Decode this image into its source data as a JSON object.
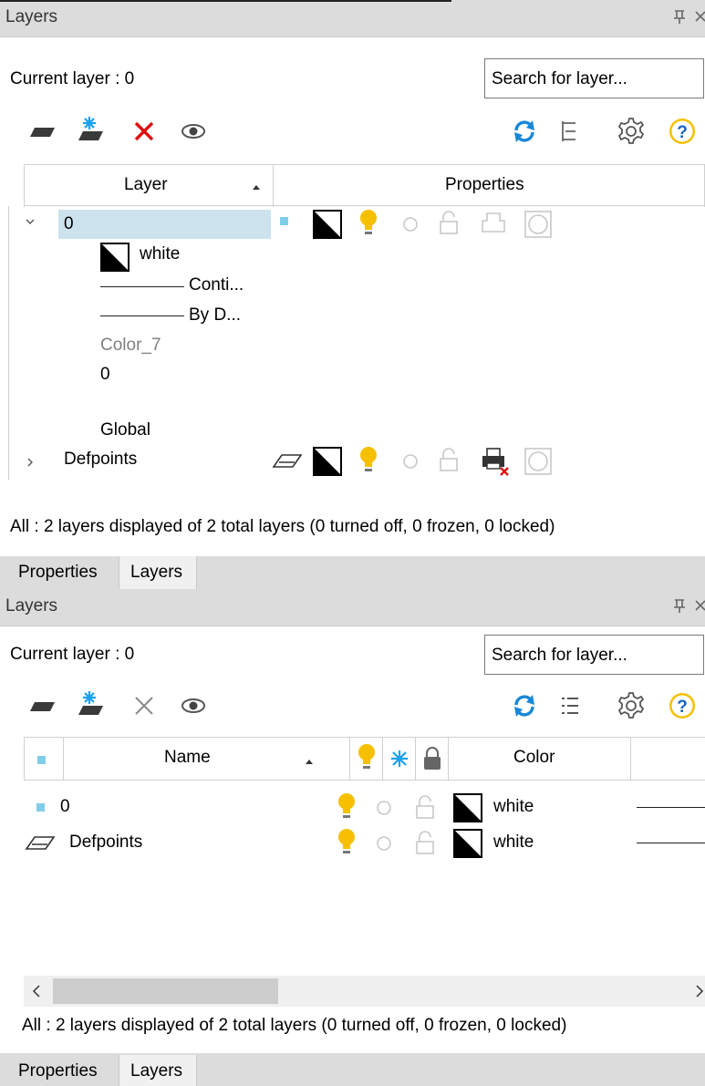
{
  "panel_top": {
    "title": "Layers",
    "current_layer": "Current layer : 0",
    "search_placeholder": "Search for layer...",
    "toolbar": [
      "new-layer-icon",
      "new-layer-frozen-icon",
      "delete-layer-icon",
      "isolate-eye-icon",
      "refresh-icon",
      "list-view-icon",
      "settings-icon",
      "help-icon"
    ],
    "columns": {
      "layer": "Layer",
      "properties": "Properties"
    },
    "tree": {
      "layer0": {
        "name": "0",
        "color_name": "white",
        "linetype": "Conti...",
        "lineweight": "By D...",
        "plot_style": "Color_7",
        "transparency": "0",
        "scope": "Global"
      },
      "defpoints": {
        "name": "Defpoints"
      }
    },
    "status": "All : 2 layers displayed of 2 total layers (0 turned off, 0 frozen, 0 locked)",
    "tabs": [
      "Properties",
      "Layers"
    ]
  },
  "panel_bottom": {
    "title": "Layers",
    "current_layer": "Current layer : 0",
    "search_placeholder": "Search for layer...",
    "columns": {
      "name": "Name",
      "color": "Color"
    },
    "rows": [
      {
        "name": "0",
        "color": "white"
      },
      {
        "name": "Defpoints",
        "color": "white"
      }
    ],
    "status": "All : 2 layers displayed of 2 total layers (0 turned off, 0 frozen, 0 locked)",
    "tabs": [
      "Properties",
      "Layers"
    ]
  },
  "colors": {
    "titlebar": "#dcdcdc",
    "selection": "#cce3ee",
    "current_marker": "#7fcde8",
    "bulb": "#f6c000",
    "refresh": "#1a88d8",
    "delete_red": "#e01010",
    "freeze_blue": "#1aa0f0"
  }
}
